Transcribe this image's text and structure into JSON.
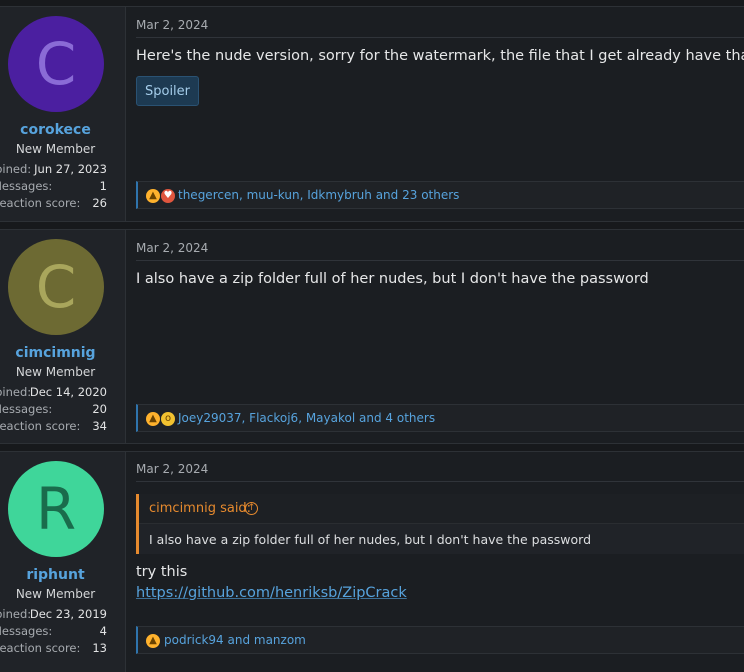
{
  "posts": [
    {
      "user": {
        "initial": "C",
        "avatar_bg": "#4b1fa0",
        "avatar_fg": "#8a6bd6",
        "name": "corokece",
        "title": "New Member",
        "joined_label": "Joined:",
        "joined": "Jun 27, 2023",
        "messages_label": "Messages:",
        "messages": "1",
        "reaction_label": "Reaction score:",
        "reaction": "26"
      },
      "date": "Mar 2, 2024",
      "text": "Here's the nude version, sorry for the watermark, the file that I get already have that",
      "spoiler_label": "Spoiler",
      "reactions": {
        "icons": [
          "like-icon",
          "love-icon"
        ],
        "names": "thegercen, muu-kun, Idkmybruh",
        "and": " and ",
        "others": "23 others"
      }
    },
    {
      "user": {
        "initial": "C",
        "avatar_bg": "#6d6a33",
        "avatar_fg": "#a9a65c",
        "name": "cimcimnig",
        "title": "New Member",
        "joined_label": "Joined:",
        "joined": "Dec 14, 2020",
        "messages_label": "Messages:",
        "messages": "20",
        "reaction_label": "Reaction score:",
        "reaction": "34"
      },
      "date": "Mar 2, 2024",
      "text": "I also have a zip folder full of her nudes, but I don't have the password",
      "reactions": {
        "icons": [
          "like-icon",
          "wow-icon"
        ],
        "names": "Joey29037, Flackoj6, Mayakol",
        "and": " and ",
        "others": "4 others"
      }
    },
    {
      "user": {
        "initial": "R",
        "avatar_bg": "#3fd69a",
        "avatar_fg": "#1a6c4c",
        "name": "riphunt",
        "title": "New Member",
        "joined_label": "Joined:",
        "joined": "Dec 23, 2019",
        "messages_label": "Messages:",
        "messages": "4",
        "reaction_label": "Reaction score:",
        "reaction": "13"
      },
      "date": "Mar 2, 2024",
      "quote": {
        "author": "cimcimnig said:",
        "text": "I also have a zip folder full of her nudes, but I don't have the password"
      },
      "text": "try this",
      "link": "https://github.com/henriksb/ZipCrack",
      "reactions": {
        "icons": [
          "like-icon"
        ],
        "names": "podrick94",
        "and": " and ",
        "others": "manzom"
      }
    }
  ],
  "colors": {
    "accent": "#57a3dd",
    "quote_accent": "#e68a2e"
  }
}
